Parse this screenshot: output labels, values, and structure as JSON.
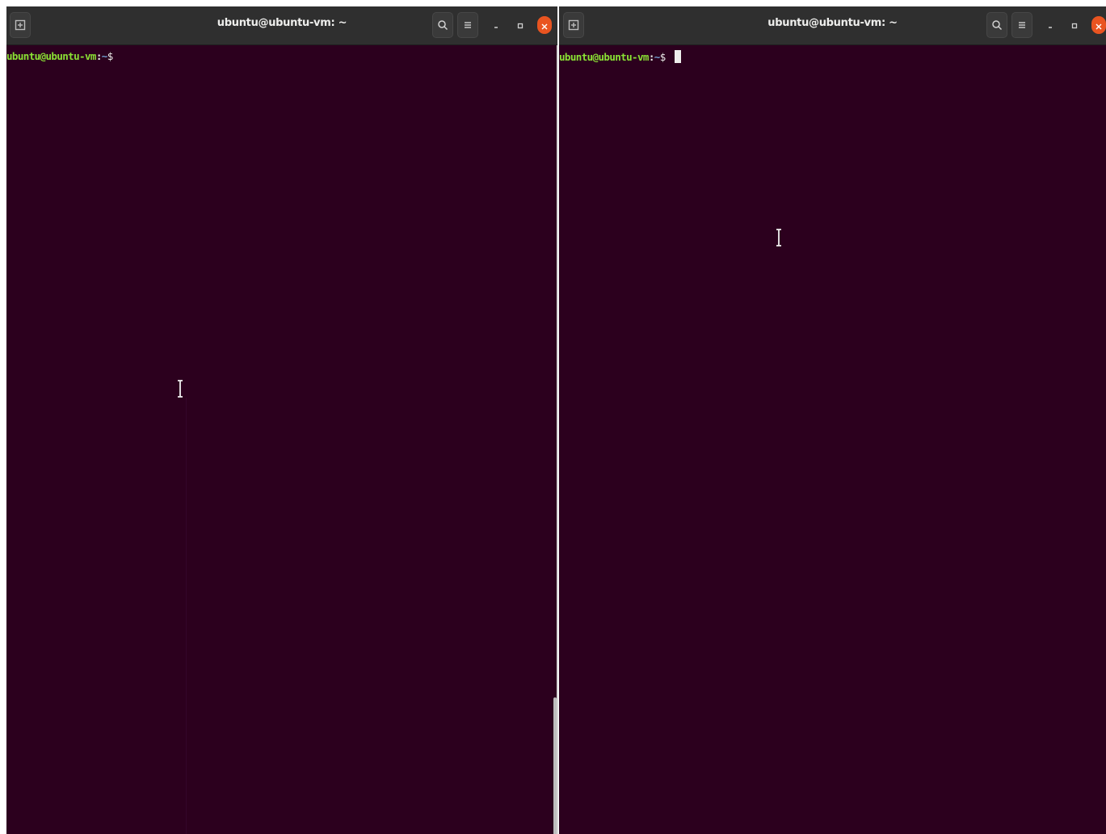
{
  "colors": {
    "terminal_bg": "#2c001e",
    "titlebar_bg": "#2f2f2f",
    "prompt_user": "#8ae234",
    "prompt_path": "#729fcf",
    "close_button": "#e95420"
  },
  "icons": {
    "new_tab": "new-tab-icon",
    "search": "search-icon",
    "menu": "hamburger-menu-icon",
    "minimize": "minimize-icon",
    "maximize": "maximize-icon",
    "close": "close-icon",
    "text_cursor": "ibeam-cursor-icon"
  },
  "left_window": {
    "title": "ubuntu@ubuntu-vm: ~",
    "prompt": {
      "user_host": "ubuntu@ubuntu-vm",
      "colon": ":",
      "path": "~",
      "dollar": "$"
    }
  },
  "right_window": {
    "title": "ubuntu@ubuntu-vm: ~",
    "prompt": {
      "user_host": "ubuntu@ubuntu-vm",
      "colon": ":",
      "path": "~",
      "dollar": "$ "
    }
  }
}
